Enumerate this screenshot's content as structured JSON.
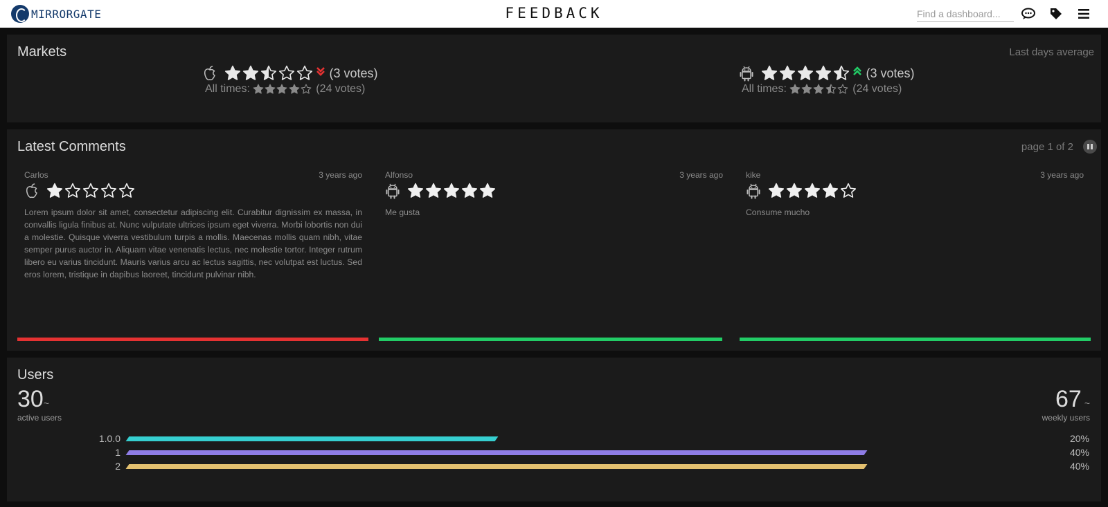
{
  "header": {
    "logo_text": "MIRRORGATE",
    "page_title": "FEEDBACK",
    "search_placeholder": "Find a dashboard...",
    "icons": [
      "comments-icon",
      "tag-icon",
      "menu-icon"
    ]
  },
  "colors": {
    "background": "#0e0e0e",
    "panel": "#1b1b1b",
    "negative": "#e53232",
    "positive": "#22cc66",
    "bar_1_0_0": "#36cfd0",
    "bar_1": "#8f7de6",
    "bar_2": "#e3c06f"
  },
  "markets": {
    "title": "Markets",
    "note": "Last days average",
    "items": [
      {
        "platform_icon": "apple-icon",
        "rating": 2.5,
        "trend": "down",
        "trend_icon": "chevrons-down-icon",
        "votes": "(3 votes)",
        "alltimes_label": "All times:",
        "alltimes_rating": 4,
        "alltimes_votes": "(24 votes)"
      },
      {
        "platform_icon": "android-icon",
        "rating": 4.5,
        "trend": "up",
        "trend_icon": "chevrons-up-icon",
        "votes": "(3 votes)",
        "alltimes_label": "All times:",
        "alltimes_rating": 3.5,
        "alltimes_votes": "(24 votes)"
      }
    ]
  },
  "comments": {
    "title": "Latest Comments",
    "pager": "page 1 of 2",
    "items": [
      {
        "author": "Carlos",
        "time": "3 years ago",
        "platform_icon": "apple-icon",
        "rating": 1,
        "text": "Lorem ipsum dolor sit amet, consectetur adipiscing elit. Curabitur dignissim ex massa, in convallis ligula finibus at. Nunc vulputate ultrices ipsum eget viverra. Morbi lobortis non dui a molestie. Quisque viverra vestibulum turpis a mollis. Maecenas mollis quam nibh, vitae semper purus auctor in. Aliquam vitae venenatis lectus, nec molestie tortor. Integer rutrum libero eu varius tincidunt. Mauris varius arcu ac lectus sagittis, nec volutpat est luctus. Sed eros lorem, tristique in dapibus laoreet, tincidunt pulvinar nibh.",
        "sentiment": "negative"
      },
      {
        "author": "Alfonso",
        "time": "3 years ago",
        "platform_icon": "android-icon",
        "rating": 5,
        "text": "Me gusta",
        "sentiment": "positive"
      },
      {
        "author": "kike",
        "time": "3 years ago",
        "platform_icon": "android-icon",
        "rating": 4,
        "text": "Consume mucho",
        "sentiment": "positive"
      }
    ]
  },
  "users": {
    "title": "Users",
    "active": {
      "value": "30",
      "tilde": "~",
      "label": "active users"
    },
    "weekly": {
      "value": "67",
      "tilde": "~",
      "label": "weekly users"
    },
    "versions": [
      {
        "name": "1.0.0",
        "fraction": 0.5,
        "percent": "20%"
      },
      {
        "name": "1",
        "fraction": 1.0,
        "percent": "40%"
      },
      {
        "name": "2",
        "fraction": 1.0,
        "percent": "40%"
      }
    ]
  }
}
